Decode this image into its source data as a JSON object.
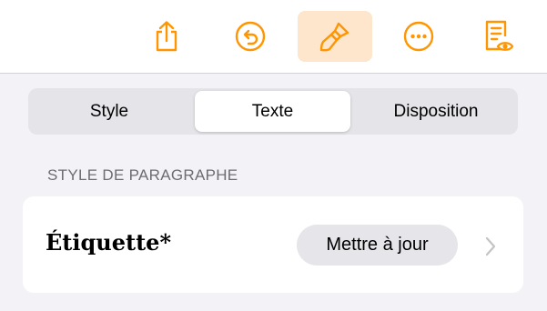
{
  "toolbar": {
    "accent_color": "#ff9500",
    "active_bg": "#fde6cc",
    "icons": [
      "share-icon",
      "undo-icon",
      "paintbrush-icon",
      "more-icon",
      "reader-view-icon"
    ],
    "active_icon": "paintbrush-icon"
  },
  "tabs": {
    "items": [
      "Style",
      "Texte",
      "Disposition"
    ],
    "selected": "Texte"
  },
  "paragraph_style": {
    "section_title": "STYLE DE PARAGRAPHE",
    "current_style": "Étiquette*",
    "update_button": "Mettre à jour"
  }
}
